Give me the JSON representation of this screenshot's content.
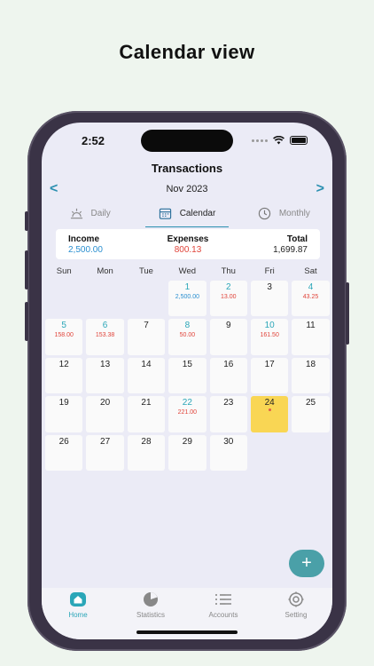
{
  "headline": "Calendar view",
  "status": {
    "time": "2:52"
  },
  "header": {
    "title": "Transactions",
    "month": "Nov 2023",
    "prev_arrow": "<",
    "next_arrow": ">"
  },
  "tabs": [
    {
      "label": "Daily",
      "icon": "sunrise-icon"
    },
    {
      "label": "Calendar",
      "icon": "calendar-icon",
      "active": true
    },
    {
      "label": "Monthly",
      "icon": "clock-icon"
    }
  ],
  "summary": {
    "income_label": "Income",
    "income_value": "2,500.00",
    "expenses_label": "Expenses",
    "expenses_value": "800.13",
    "total_label": "Total",
    "total_value": "1,699.87"
  },
  "weekdays": [
    "Sun",
    "Mon",
    "Tue",
    "Wed",
    "Thu",
    "Fri",
    "Sat"
  ],
  "calendar": {
    "leading_blanks": 3,
    "days": [
      {
        "day": "1",
        "income": "2,500.00"
      },
      {
        "day": "2",
        "expense": "13.00"
      },
      {
        "day": "3"
      },
      {
        "day": "4",
        "expense": "43.25"
      },
      {
        "day": "5",
        "expense": "158.00"
      },
      {
        "day": "6",
        "expense": "153.38"
      },
      {
        "day": "7"
      },
      {
        "day": "8",
        "expense": "50.00"
      },
      {
        "day": "9"
      },
      {
        "day": "10",
        "expense": "161.50"
      },
      {
        "day": "11"
      },
      {
        "day": "12"
      },
      {
        "day": "13"
      },
      {
        "day": "14"
      },
      {
        "day": "15"
      },
      {
        "day": "16"
      },
      {
        "day": "17"
      },
      {
        "day": "18"
      },
      {
        "day": "19"
      },
      {
        "day": "20"
      },
      {
        "day": "21"
      },
      {
        "day": "22",
        "expense": "221.00"
      },
      {
        "day": "23"
      },
      {
        "day": "24",
        "today": true
      },
      {
        "day": "25"
      },
      {
        "day": "26"
      },
      {
        "day": "27"
      },
      {
        "day": "28"
      },
      {
        "day": "29"
      },
      {
        "day": "30"
      }
    ]
  },
  "fab": {
    "label": "+"
  },
  "bottom_nav": [
    {
      "label": "Home",
      "icon": "home-icon",
      "active": true
    },
    {
      "label": "Statistics",
      "icon": "pie-chart-icon"
    },
    {
      "label": "Accounts",
      "icon": "list-icon"
    },
    {
      "label": "Setting",
      "icon": "gear-icon"
    }
  ],
  "colors": {
    "accent": "#2aa6b8",
    "income": "#2a8fd0",
    "expense": "#e0443a",
    "today": "#f9d654",
    "fab": "#4aa0a8"
  }
}
